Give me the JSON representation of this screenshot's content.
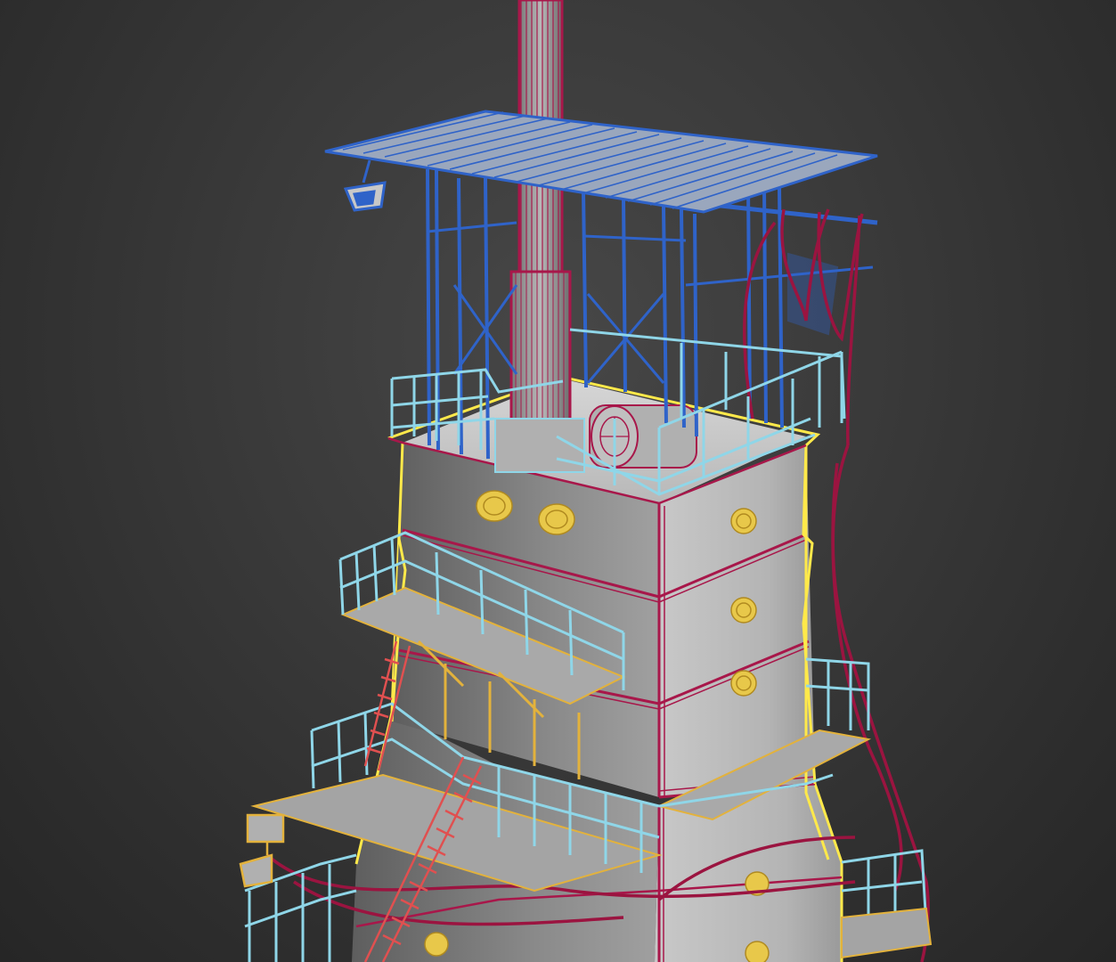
{
  "viewport": {
    "background": "#3a3a3a",
    "render_mode": "wireframe-over-shaded"
  },
  "colors": {
    "stack_pipe": "#a8174a",
    "shelter_frame": "#2f63c9",
    "railing": "#8fd6e8",
    "selection": "#ffe94a",
    "platform_edge": "#e3b23c",
    "stair": "#e05050",
    "cable": "#9b1440",
    "flange": "#e8c84a",
    "body_shade_light": "#bcbcbc",
    "body_shade_dark": "#6a6a6a"
  },
  "objects": [
    {
      "name": "exhaust-stack",
      "wire_color": "stack_pipe"
    },
    {
      "name": "roof-shelter",
      "wire_color": "shelter_frame"
    },
    {
      "name": "tower-body",
      "wire_color": "selection"
    },
    {
      "name": "railings",
      "wire_color": "railing"
    },
    {
      "name": "stairs",
      "wire_color": "stair"
    },
    {
      "name": "cables",
      "wire_color": "cable"
    },
    {
      "name": "flanges",
      "wire_color": "flange"
    }
  ]
}
